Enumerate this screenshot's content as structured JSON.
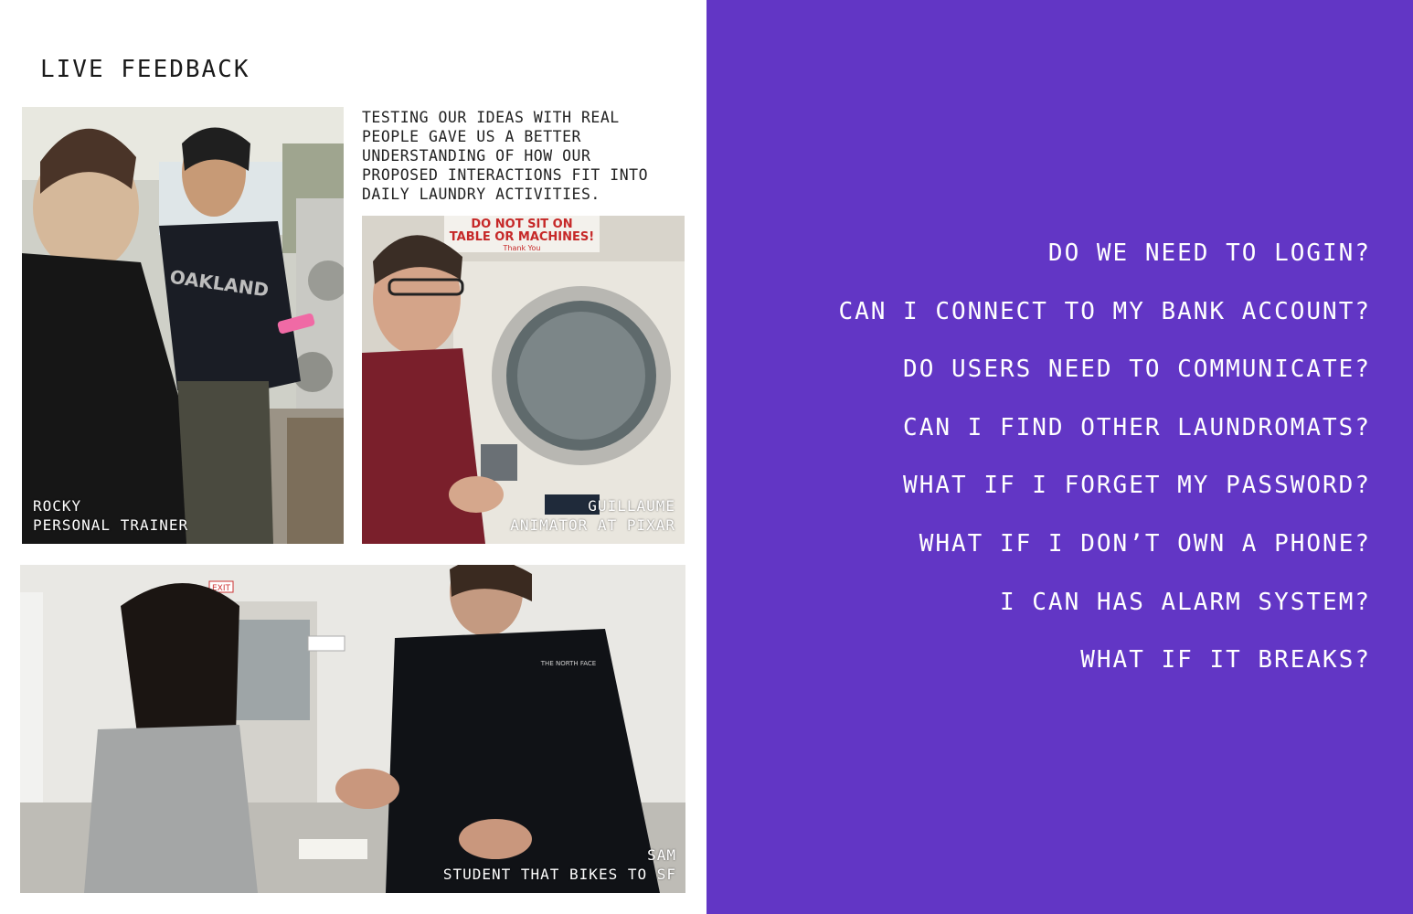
{
  "page_title": "LIVE FEEDBACK",
  "intro_text": "TESTING OUR IDEAS WITH REAL\nPEOPLE GAVE US A BETTER\nUNDERSTANDING OF HOW OUR\nPROPOSED INTERACTIONS FIT INTO\nDAILY LAUNDRY ACTIVITIES.",
  "photos": [
    {
      "name": "ROCKY",
      "role": "PERSONAL TRAINER"
    },
    {
      "name": "GUILLAUME",
      "role": "ANIMATOR AT PIXAR"
    },
    {
      "name": "SAM",
      "role": "STUDENT THAT BIKES TO SF"
    }
  ],
  "signs": {
    "exit": "EXIT",
    "machines": "DO NOT SIT ON",
    "machines_2": "TABLE OR MACHINES!",
    "thank_you": "Thank You",
    "shirt_text": "OAKLAND",
    "jacket_logo": "THE NORTH FACE"
  },
  "questions": [
    "DO WE NEED TO LOGIN?",
    "CAN I CONNECT TO MY BANK ACCOUNT?",
    "DO USERS NEED TO COMMUNICATE?",
    "CAN I FIND OTHER LAUNDROMATS?",
    "WHAT IF I FORGET MY PASSWORD?",
    "WHAT IF I DON’T OWN A PHONE?",
    "I CAN HAS ALARM SYSTEM?",
    "WHAT IF IT BREAKS?"
  ],
  "colors": {
    "accent": "#6236c5",
    "text_dark": "#1a1a1a",
    "text_light": "#ffffff"
  }
}
